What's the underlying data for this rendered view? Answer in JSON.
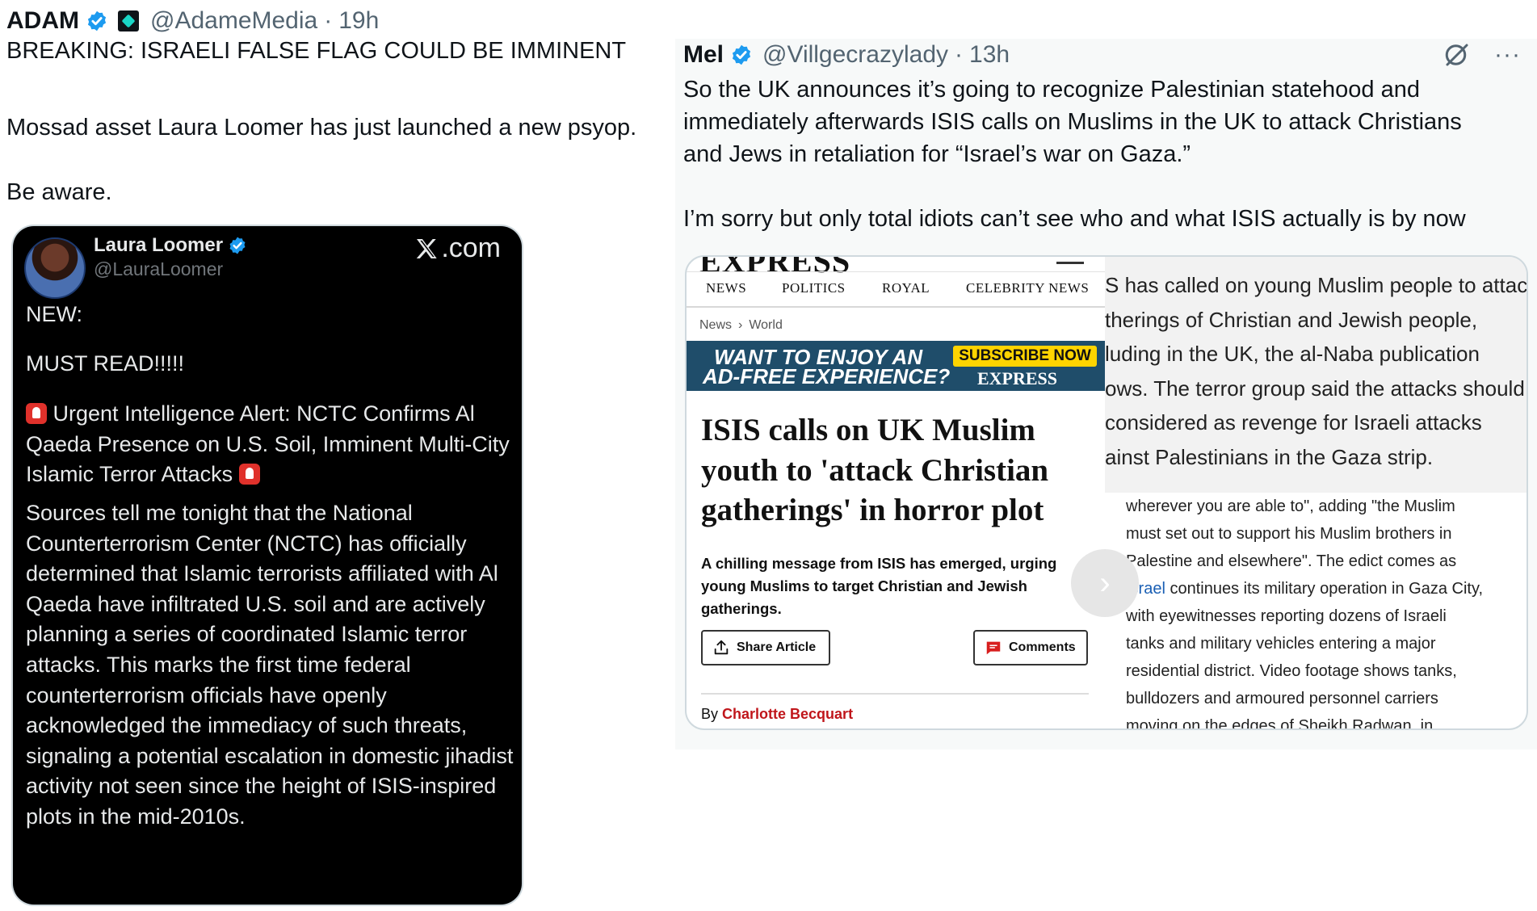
{
  "left_tweet": {
    "name": "ADAM",
    "handle": "@AdameMedia",
    "separator": "·",
    "time": "19h",
    "lines": [
      "BREAKING: ISRAELI FALSE FLAG COULD BE IMMINENT",
      "Mossad asset Laura Loomer has just launched a new psyop.",
      "Be aware."
    ],
    "embed": {
      "name": "Laura Loomer",
      "handle": "@LauraLoomer",
      "site": ".com",
      "p1": "NEW:",
      "p2": "MUST READ!!!!!",
      "p3": "Urgent Intelligence Alert: NCTC Confirms Al Qaeda Presence on U.S. Soil, Imminent Multi-City Islamic Terror Attacks",
      "p4": "Sources tell me tonight that the National Counterterrorism Center (NCTC) has officially determined that Islamic terrorists affiliated with Al Qaeda have infiltrated U.S. soil and are actively planning a series of coordinated Islamic terror attacks. This marks the first time federal counterterrorism officials have openly acknowledged the immediacy of such threats, signaling a potential escalation in domestic jihadist activity not seen since the height of ISIS-inspired plots in the mid-2010s."
    }
  },
  "right_tweet": {
    "name": "Mel",
    "handle": "@Villgecrazylady",
    "separator": "·",
    "time": "13h",
    "more": "···",
    "lines": [
      "So the UK announces it’s going to recognize Palestinian statehood and",
      "immediately afterwards ISIS calls on Muslims in the UK to attack Christians",
      "and Jews in retaliation for “Israel’s war on Gaza.”",
      "I’m sorry but only total idiots can’t see who and what ISIS actually is by now"
    ],
    "article": {
      "logo_partial": "EXPRESS",
      "nav": [
        "NEWS",
        "POLITICS",
        "ROYAL",
        "CELEBRITY NEWS"
      ],
      "crumb": [
        "News",
        "World"
      ],
      "banner_text": [
        "WANT TO ENJOY AN",
        "AD-FREE EXPERIENCE?"
      ],
      "banner_subscribe": "SUBSCRIBE NOW",
      "banner_logo": "EXPRESS",
      "headline": "ISIS calls on UK Muslim youth to 'attack Christian gatherings' in horror plot",
      "standfirst": "A chilling message from ISIS has emerged, urging young Muslims to target Christian and Jewish gatherings.",
      "share_label": "Share Article",
      "comments_label": "Comments",
      "by_label": "By",
      "author": "Charlotte Becquart"
    },
    "continuation_top": [
      "S has called on young Muslim people to attac",
      "therings of Christian and Jewish people,",
      "luding in the UK, the al-Naba publication",
      "ows. The terror group said the attacks should",
      " considered as revenge for Israeli attacks",
      "ainst Palestinians in the Gaza strip."
    ],
    "continuation_bottom": {
      "l1": "wherever you are able to\", adding \"the Muslim",
      "l2": "must set out to support his Muslim brothers in",
      "l3": "Palestine and elsewhere\". The edict comes as",
      "l4_link": "Israel",
      "l4_rest": " continues its military operation in Gaza City,",
      "l5": "with eyewitnesses reporting dozens of Israeli",
      "l6": "tanks and military vehicles entering a major",
      "l7": "residential district. Video footage shows tanks,",
      "l8": "bulldozers and armoured personnel carriers",
      "l9": "moving on the edges of Sheikh Radwan, in"
    }
  },
  "colors": {
    "verified_blue": "#1d9bf0",
    "express_red": "#c0161b",
    "banner_blue": "#1f4d6a",
    "subscribe_yellow": "#ffd400"
  }
}
